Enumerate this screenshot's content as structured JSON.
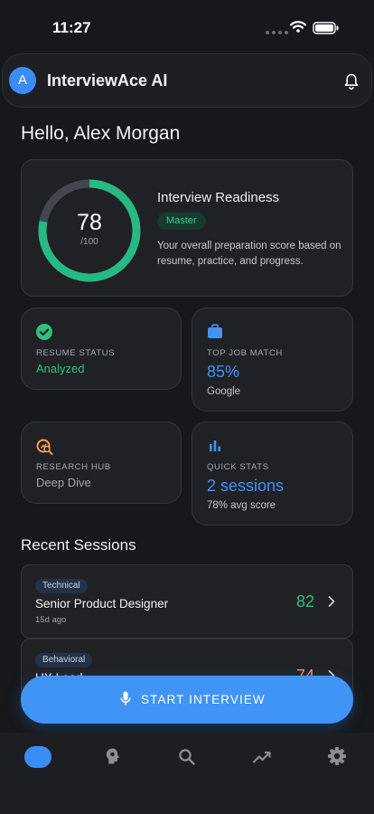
{
  "status_bar": {
    "time": "11:27"
  },
  "app_bar": {
    "avatar_initial": "A",
    "title": "InterviewAce AI"
  },
  "greeting": "Hello, Alex Morgan",
  "readiness": {
    "score": "78",
    "max": "/100",
    "progress": 0.78,
    "title": "Interview Readiness",
    "level": "Master",
    "description": "Your overall preparation score based on resume, practice, and progress."
  },
  "cards": {
    "resume": {
      "label": "RESUME STATUS",
      "value": "Analyzed"
    },
    "job_match": {
      "label": "TOP JOB MATCH",
      "value": "85%",
      "sub": "Google"
    },
    "research": {
      "label": "RESEARCH HUB",
      "value": "Deep Dive"
    },
    "quick_stats": {
      "label": "QUICK STATS",
      "value": "2 sessions",
      "sub": "78% avg score"
    }
  },
  "recent_sessions": {
    "title": "Recent Sessions",
    "items": [
      {
        "tag": "Technical",
        "title": "Senior Product Designer",
        "date": "15d ago",
        "score": "82"
      },
      {
        "tag": "Behavioral",
        "title": "UX Lead",
        "score": "74"
      }
    ]
  },
  "cta": {
    "label": "START INTERVIEW"
  },
  "colors": {
    "accent": "#3f94f6",
    "success": "#2ec07c",
    "warning": "#f0a04b",
    "background": "#17181b"
  }
}
